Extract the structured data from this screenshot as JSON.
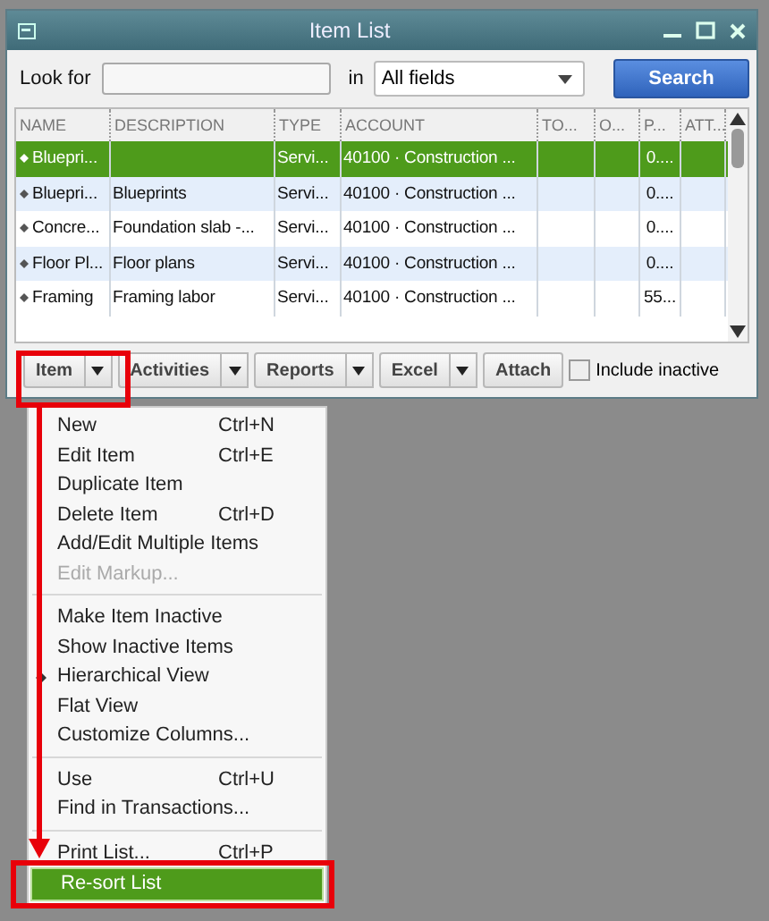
{
  "window": {
    "title": "Item List"
  },
  "search": {
    "label": "Look for",
    "in_label": "in",
    "scope": "All fields",
    "button": "Search"
  },
  "table": {
    "columns": [
      "NAME",
      "DESCRIPTION",
      "TYPE",
      "ACCOUNT",
      "TO...",
      "O...",
      "P...",
      "ATT..."
    ],
    "rows": [
      {
        "cells": [
          "Bluepri...",
          "",
          "Servi...",
          "40100 · Construction ...",
          "",
          "",
          "0....",
          ""
        ],
        "selected": true
      },
      {
        "cells": [
          "Bluepri...",
          "Blueprints",
          "Servi...",
          "40100 · Construction ...",
          "",
          "",
          "0....",
          ""
        ],
        "selected": false
      },
      {
        "cells": [
          "Concre...",
          "Foundation slab -...",
          "Servi...",
          "40100 · Construction ...",
          "",
          "",
          "0....",
          ""
        ],
        "selected": false
      },
      {
        "cells": [
          "Floor Pl...",
          "Floor plans",
          "Servi...",
          "40100 · Construction ...",
          "",
          "",
          "0....",
          ""
        ],
        "selected": false
      },
      {
        "cells": [
          "Framing",
          "Framing labor",
          "Servi...",
          "40100 · Construction ...",
          "",
          "",
          "55...",
          ""
        ],
        "selected": false
      }
    ]
  },
  "toolbar": [
    {
      "label": "Item",
      "kind": "dropdown"
    },
    {
      "label": "Activities",
      "kind": "dropdown"
    },
    {
      "label": "Reports",
      "kind": "dropdown"
    },
    {
      "label": "Excel",
      "kind": "dropdown"
    },
    {
      "label": "Attach",
      "kind": "button"
    }
  ],
  "include_inactive": {
    "label": "Include inactive",
    "checked": false
  },
  "menu": [
    {
      "kind": "item",
      "label": "New",
      "shortcut": "Ctrl+N",
      "disabled": false,
      "checked": false,
      "selected": false
    },
    {
      "kind": "item",
      "label": "Edit Item",
      "shortcut": "Ctrl+E",
      "disabled": false,
      "checked": false,
      "selected": false
    },
    {
      "kind": "item",
      "label": "Duplicate Item",
      "disabled": false,
      "checked": false,
      "selected": false
    },
    {
      "kind": "item",
      "label": "Delete Item",
      "shortcut": "Ctrl+D",
      "disabled": false,
      "checked": false,
      "selected": false
    },
    {
      "kind": "item",
      "label": "Add/Edit Multiple Items",
      "disabled": false,
      "checked": false,
      "selected": false
    },
    {
      "kind": "item",
      "label": "Edit Markup...",
      "disabled": true,
      "checked": false,
      "selected": false
    },
    {
      "kind": "separator"
    },
    {
      "kind": "item",
      "label": "Make Item Inactive",
      "disabled": false,
      "checked": false,
      "selected": false
    },
    {
      "kind": "item",
      "label": "Show Inactive Items",
      "disabled": false,
      "checked": false,
      "selected": false
    },
    {
      "kind": "item",
      "label": "Hierarchical View",
      "disabled": false,
      "checked": true,
      "selected": false
    },
    {
      "kind": "item",
      "label": "Flat View",
      "disabled": false,
      "checked": false,
      "selected": false
    },
    {
      "kind": "item",
      "label": "Customize Columns...",
      "disabled": false,
      "checked": false,
      "selected": false
    },
    {
      "kind": "separator"
    },
    {
      "kind": "item",
      "label": "Use",
      "shortcut": "Ctrl+U",
      "disabled": false,
      "checked": false,
      "selected": false
    },
    {
      "kind": "item",
      "label": "Find in Transactions...",
      "disabled": false,
      "checked": false,
      "selected": false
    },
    {
      "kind": "separator"
    },
    {
      "kind": "item",
      "label": "Print List...",
      "shortcut": "Ctrl+P",
      "disabled": false,
      "checked": false,
      "selected": false
    },
    {
      "kind": "item",
      "label": "Re-sort List",
      "disabled": false,
      "checked": false,
      "selected": true
    }
  ]
}
